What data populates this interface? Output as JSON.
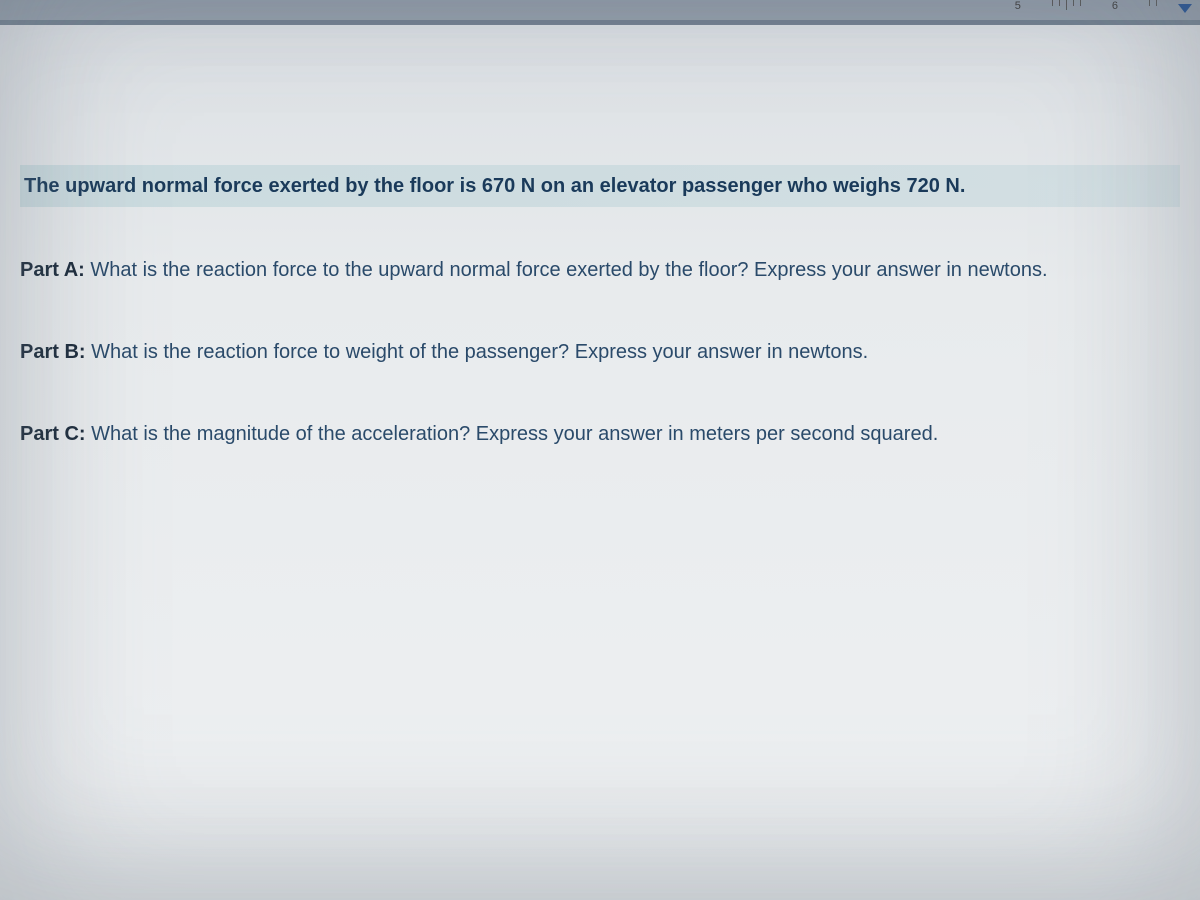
{
  "ruler": {
    "mark_5": "5",
    "mark_6": "6"
  },
  "problem": {
    "statement": "The upward normal force exerted by the floor is 670 N on an elevator passenger who weighs 720 N."
  },
  "parts": {
    "a": {
      "label": "Part A:",
      "text": " What is the reaction force to the upward normal force exerted by the floor? Express your answer in newtons."
    },
    "b": {
      "label": "Part B:",
      "text": " What is the reaction force to weight of the passenger? Express your answer in newtons."
    },
    "c": {
      "label": "Part C:",
      "text": " What is the magnitude of the acceleration? Express your answer in meters per second squared."
    }
  }
}
